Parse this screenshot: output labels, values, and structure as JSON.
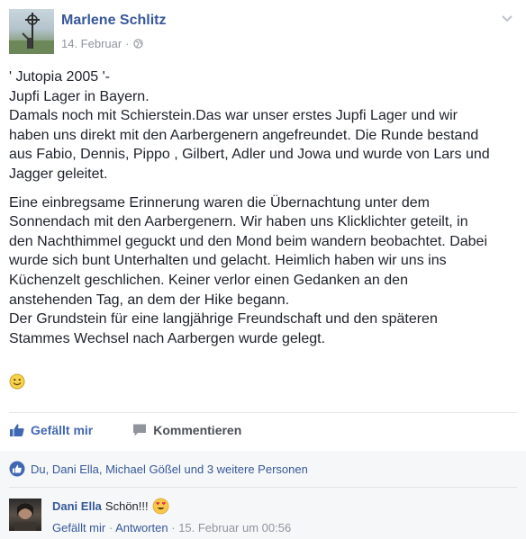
{
  "post": {
    "author": "Marlene Schlitz",
    "date": "14. Februar",
    "date_separator": "·",
    "privacy_icon": "globe-icon",
    "menu_icon": "chevron-down-icon",
    "lines": [
      "' Jutopia 2005 '-",
      "Jupfi Lager in Bayern.",
      "Damals noch mit Schierstein.Das war unser erstes Jupfi Lager und wir",
      "haben uns direkt mit den Aarbergenern angefreundet. Die Runde bestand",
      "aus Fabio, Dennis, Pippo , Gilbert, Adler und Jowa und wurde von Lars und",
      "Jagger geleitet."
    ],
    "lines2": [
      "Eine einbregsame Erinnerung waren die Übernachtung unter dem",
      "Sonnendach mit den Aarbergenern. Wir haben uns Klicklichter geteilt, in",
      "den Nachthimmel geguckt und den Mond beim wandern beobachtet. Dabei",
      "wurde sich bunt Unterhalten und gelacht. Heimlich haben wir uns ins",
      "Küchenzelt geschlichen. Keiner verlor einen Gedanken an den",
      "anstehenden Tag, an dem der Hike begann.",
      "Der Grundstein für eine langjährige Freundschaft und den späteren",
      "Stammes Wechsel nach Aarbergen wurde gelegt."
    ],
    "emoji": "smiley-emoji"
  },
  "actions": {
    "like_label": "Gefällt mir",
    "comment_label": "Kommentieren"
  },
  "likes": {
    "summary": "Du, Dani Ella, Michael Gößel und 3 weitere Personen"
  },
  "comment": {
    "author": "Dani Ella",
    "text": "Schön!!!",
    "emoji": "heart-eyes-emoji",
    "like_label": "Gefällt mir",
    "separator1": " · ",
    "reply_label": "Antworten",
    "separator2": " · ",
    "timestamp": "15. Februar um 00:56"
  },
  "colors": {
    "link": "#365899",
    "like_blue": "#4267b2",
    "muted": "#90949c",
    "footer_bg": "#f6f7f9"
  }
}
